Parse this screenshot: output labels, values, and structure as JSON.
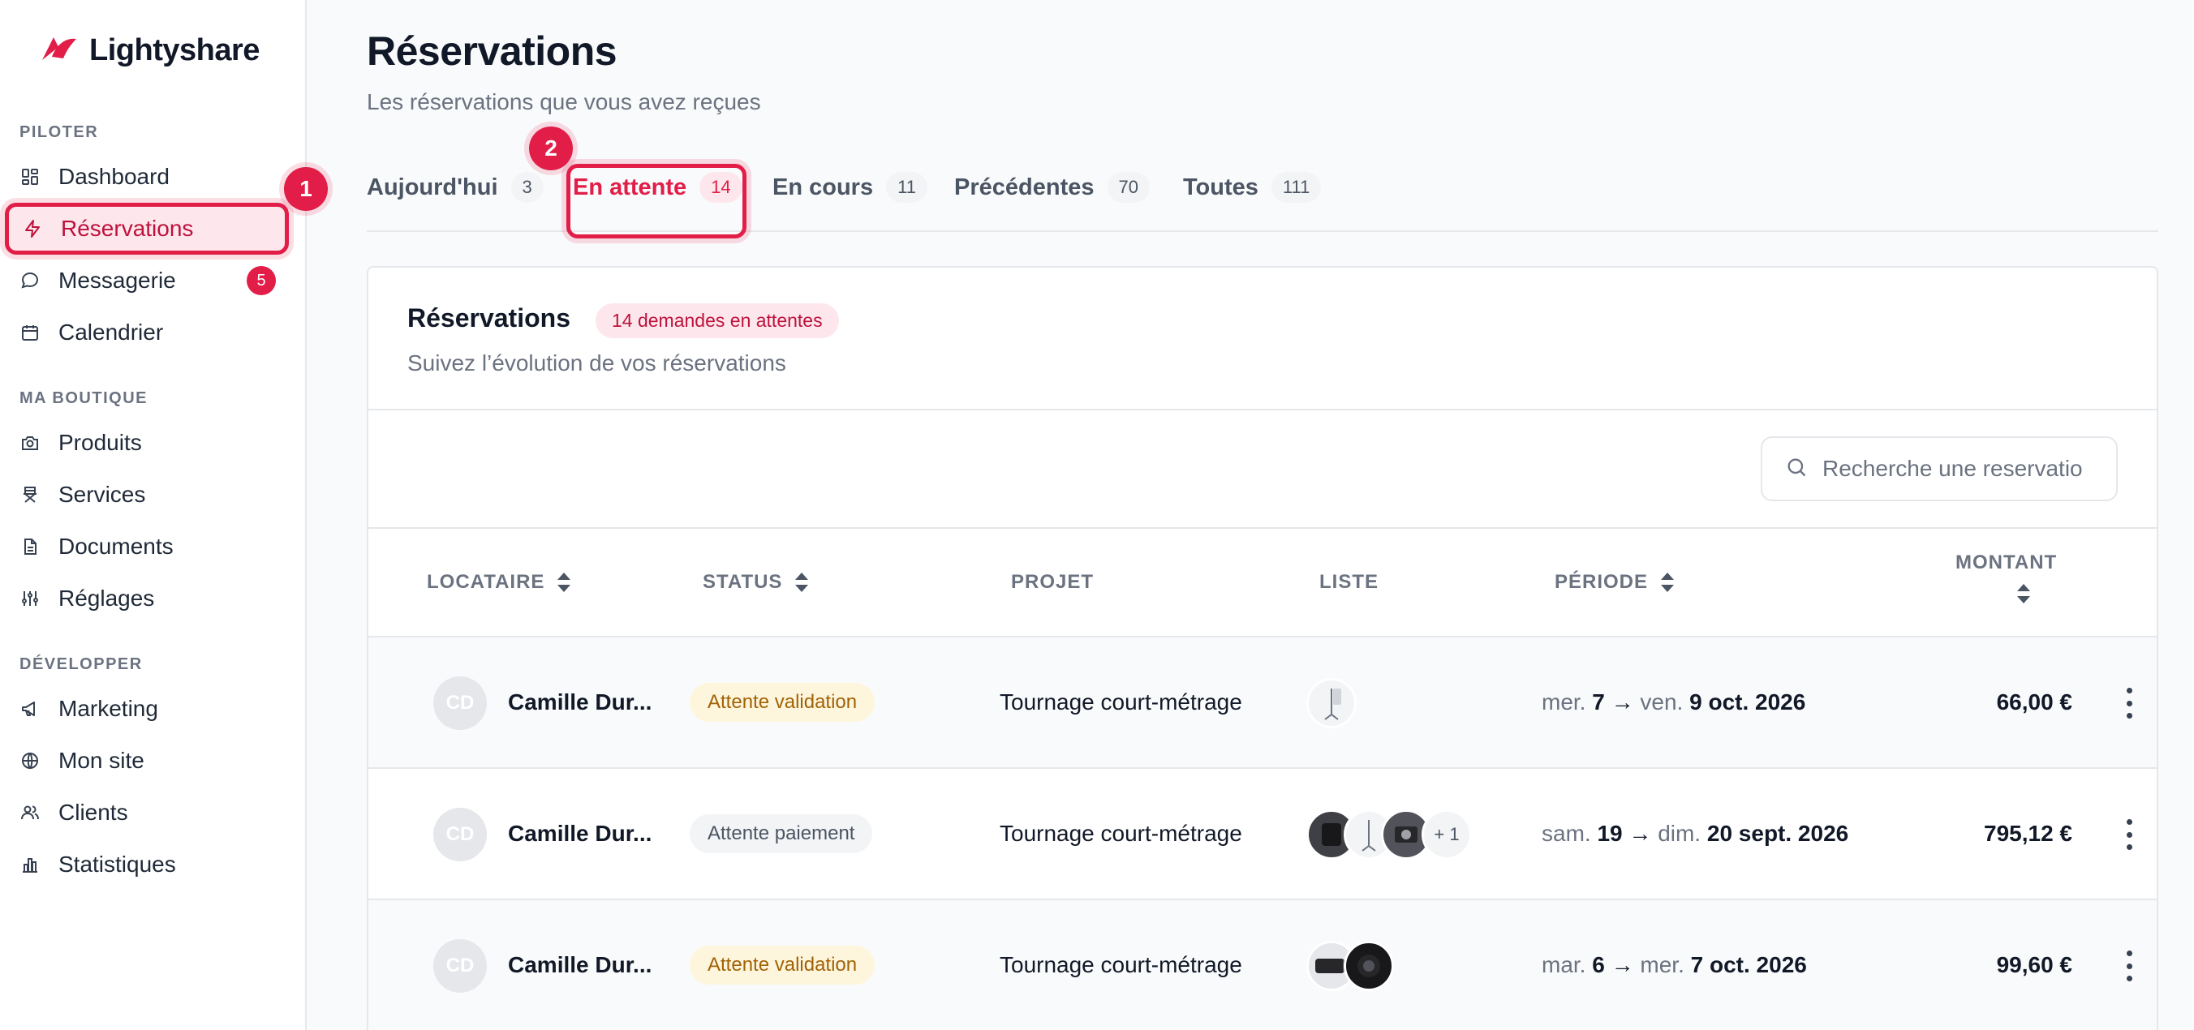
{
  "brand": {
    "name": "Lightyshare",
    "accent": "#e11d48"
  },
  "sidebar": {
    "sections": [
      {
        "label": "PILOTER"
      },
      {
        "label": "MA BOUTIQUE"
      },
      {
        "label": "DÉVELOPPER"
      }
    ],
    "items": [
      {
        "label": "Dashboard",
        "icon": "dashboard-icon"
      },
      {
        "label": "Réservations",
        "icon": "lightning-icon",
        "active": true
      },
      {
        "label": "Messagerie",
        "icon": "chat-icon",
        "badge": "5"
      },
      {
        "label": "Calendrier",
        "icon": "calendar-icon"
      },
      {
        "label": "Produits",
        "icon": "camera-icon"
      },
      {
        "label": "Services",
        "icon": "director-chair-icon"
      },
      {
        "label": "Documents",
        "icon": "document-icon"
      },
      {
        "label": "Réglages",
        "icon": "sliders-icon"
      },
      {
        "label": "Marketing",
        "icon": "megaphone-icon"
      },
      {
        "label": "Mon site",
        "icon": "globe-icon"
      },
      {
        "label": "Clients",
        "icon": "users-icon"
      },
      {
        "label": "Statistiques",
        "icon": "bar-chart-icon"
      }
    ]
  },
  "markers": {
    "one": "1",
    "two": "2"
  },
  "header": {
    "title": "Réservations",
    "subtitle": "Les réservations que vous avez reçues"
  },
  "tabs": [
    {
      "label": "Aujourd'hui",
      "count": "3"
    },
    {
      "label": "En attente",
      "count": "14",
      "active": true
    },
    {
      "label": "En cours",
      "count": "11"
    },
    {
      "label": "Précédentes",
      "count": "70"
    },
    {
      "label": "Toutes",
      "count": "111"
    }
  ],
  "card": {
    "title": "Réservations",
    "badge": "14 demandes en attentes",
    "subtitle": "Suivez l’évolution de vos réservations",
    "search_placeholder": "Recherche une reservatio"
  },
  "table": {
    "columns": {
      "locataire": "LOCATAIRE",
      "status": "STATUS",
      "projet": "PROJET",
      "liste": "LISTE",
      "periode": "PÉRIODE",
      "montant": "MONTANT"
    },
    "rows": [
      {
        "initials": "CD",
        "name": "Camille Dur...",
        "status": "Attente validation",
        "status_kind": "validation",
        "project": "Tournage court-métrage",
        "more": "",
        "period": {
          "d1": "mer.",
          "n1": "7",
          "d2": "ven.",
          "n2": "9 oct. 2026"
        },
        "amount": "66,00 €"
      },
      {
        "initials": "CD",
        "name": "Camille Dur...",
        "status": "Attente paiement",
        "status_kind": "paiement",
        "project": "Tournage court-métrage",
        "more": "+ 1",
        "period": {
          "d1": "sam.",
          "n1": "19",
          "d2": "dim.",
          "n2": "20 sept. 2026"
        },
        "amount": "795,12 €"
      },
      {
        "initials": "CD",
        "name": "Camille Dur...",
        "status": "Attente validation",
        "status_kind": "validation",
        "project": "Tournage court-métrage",
        "more": "",
        "period": {
          "d1": "mar.",
          "n1": "6",
          "d2": "mer.",
          "n2": "7 oct. 2026"
        },
        "amount": "99,60 €"
      }
    ]
  }
}
